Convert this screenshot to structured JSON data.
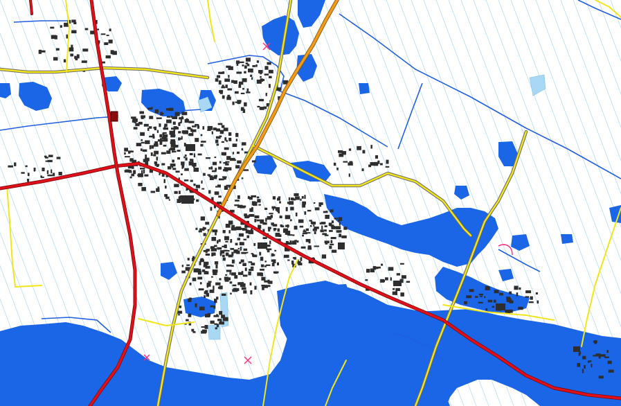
{
  "map": {
    "kind": "flood extent map over topographic base",
    "colors": {
      "background": "#ffffff",
      "flood_water": "#1a66e6",
      "surface_water": "#a9d8f5",
      "ditch_lines": "#b8dcef",
      "highway": "#f29a1a",
      "main_road": "#e0101a",
      "secondary_road": "#f2e61a",
      "local_road": "#ffffff",
      "road_casing": "#6a6a6a",
      "waterway": "#1f5fe0",
      "buildings": "#2e2e2e",
      "landmark": "#8b0a0a"
    }
  }
}
